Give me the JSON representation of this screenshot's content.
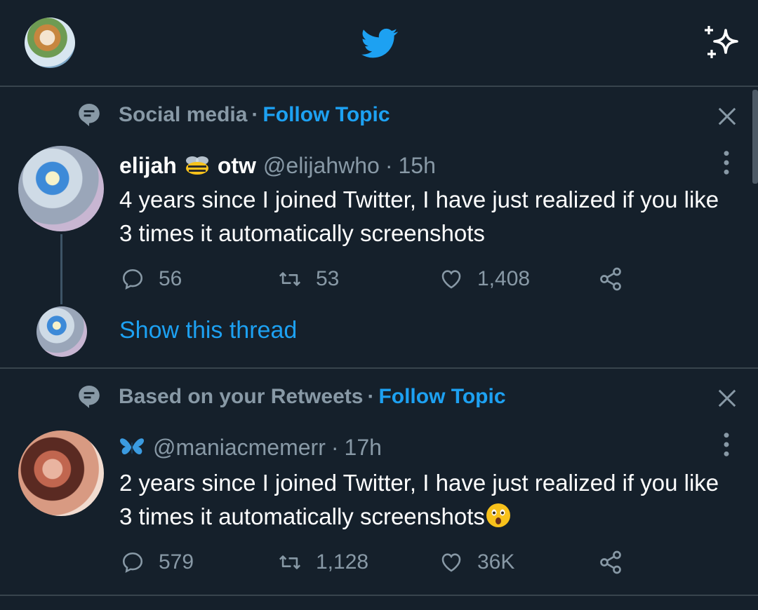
{
  "colors": {
    "background": "#15202b",
    "accent": "#1da1f2",
    "muted": "#8899a6",
    "divider": "#38444d"
  },
  "topbar": {
    "avatar_icon": "profile-avatar",
    "logo_icon": "twitter-bird-icon",
    "sparkle_icon": "sparkle-icon"
  },
  "tweets": [
    {
      "context": {
        "label": "Social media",
        "dot": "·",
        "follow": "Follow Topic"
      },
      "name": "elijah",
      "name_suffix": "otw",
      "handle": "@elijahwho",
      "dot": "·",
      "time": "15h",
      "text": "4 years since I joined Twitter, I have just realized if you like 3 times it automatically screenshots",
      "stats": {
        "replies": "56",
        "retweets": "53",
        "likes": "1,408"
      },
      "show_thread": "Show this thread"
    },
    {
      "context": {
        "label": "Based on your Retweets",
        "dot": "·",
        "follow": "Follow Topic"
      },
      "handle": "@maniacmemerr",
      "dot": "·",
      "time": "17h",
      "text": "2 years since I joined Twitter, I have just realized if you like 3 times it automatically screenshots",
      "stats": {
        "replies": "579",
        "retweets": "1,128",
        "likes": "36K"
      }
    }
  ]
}
